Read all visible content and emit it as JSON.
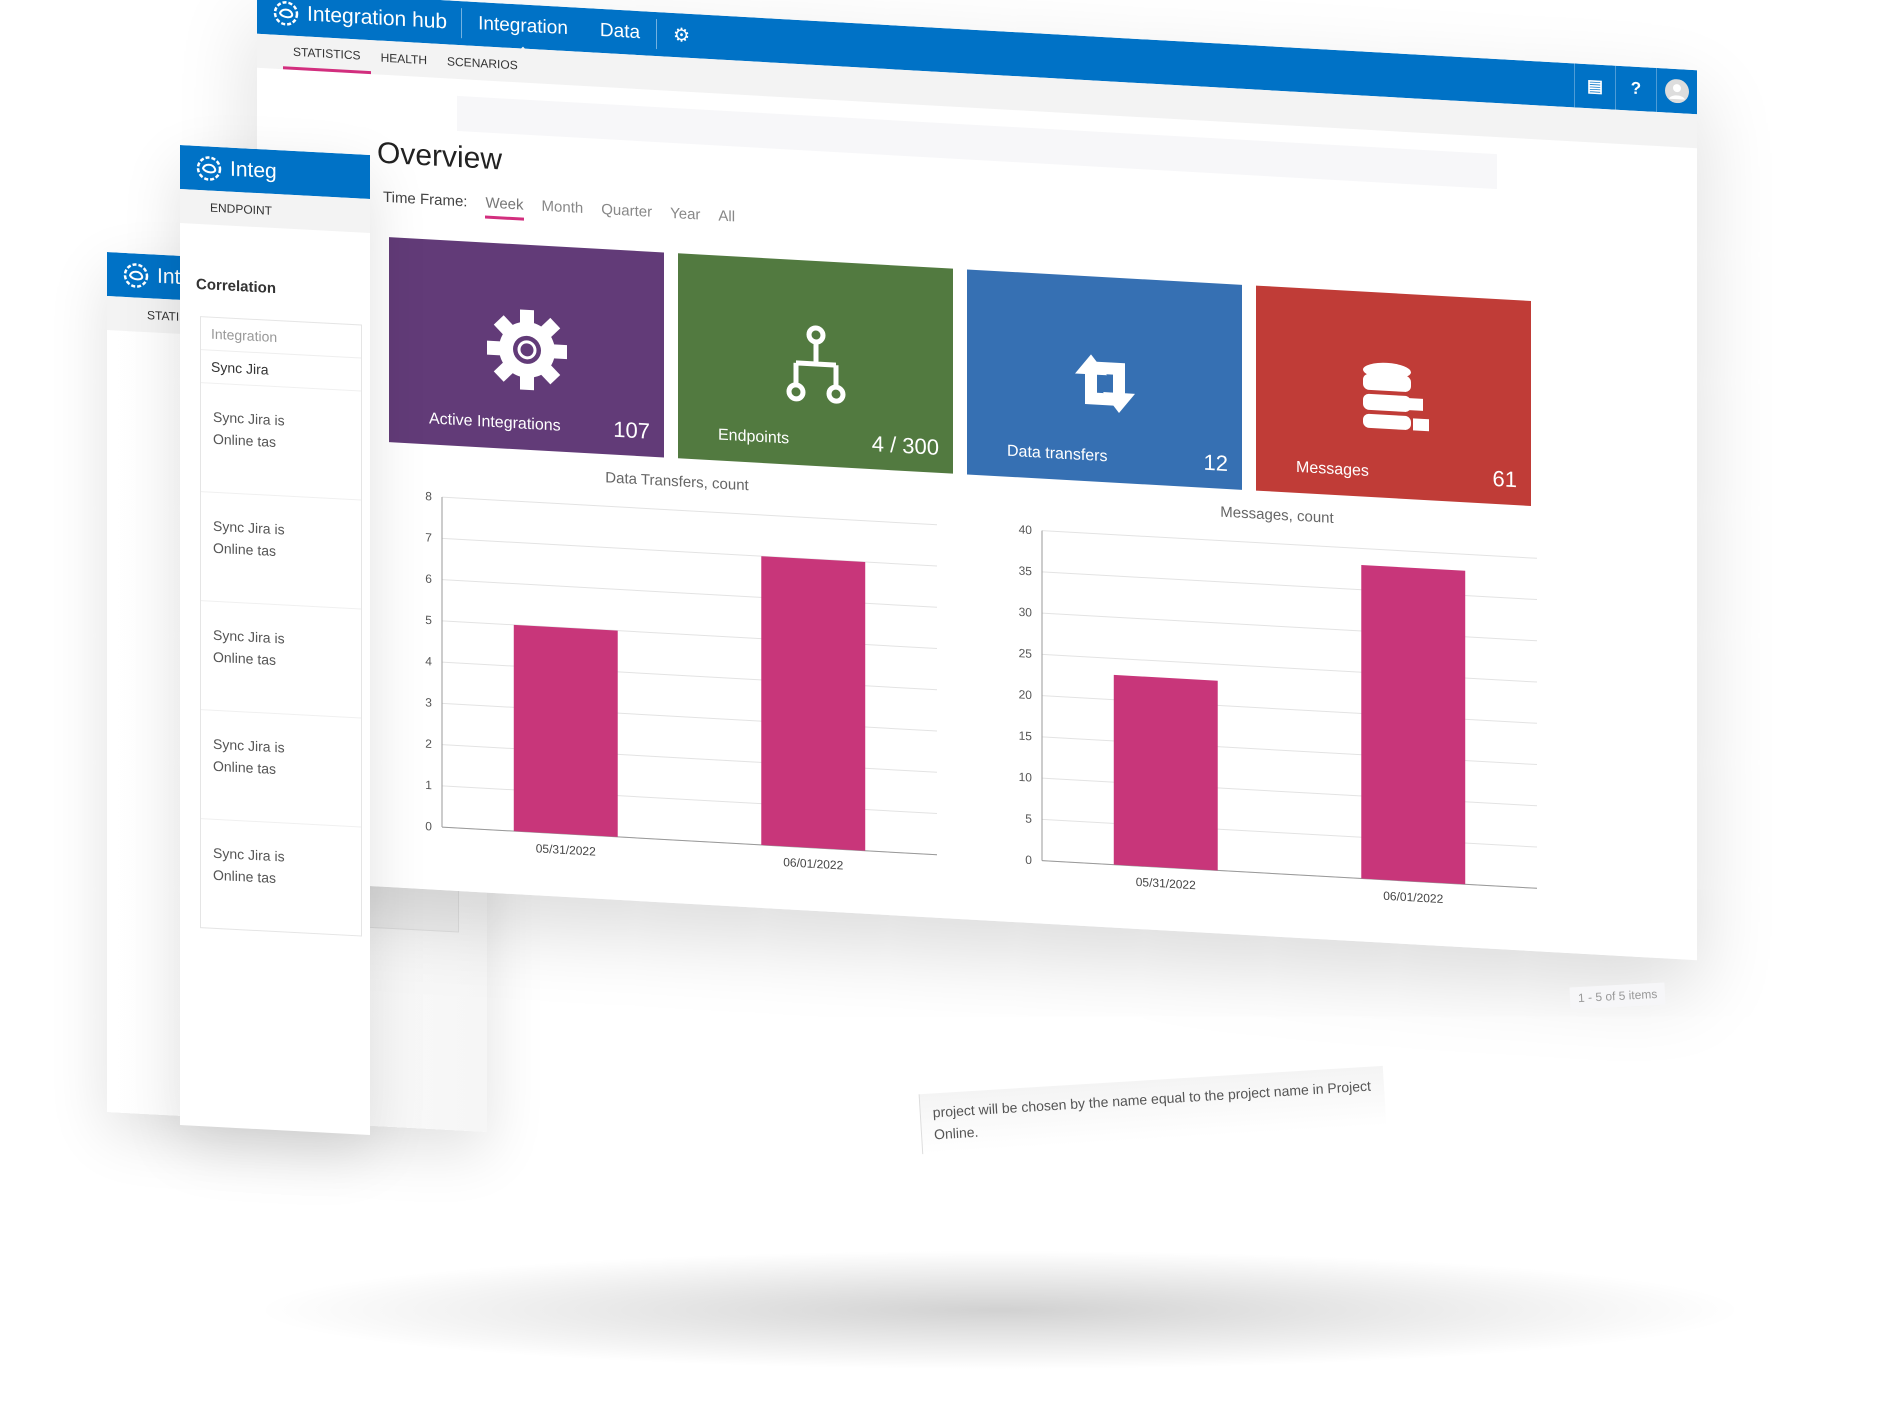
{
  "app": {
    "title": "Integration hub",
    "brand_color": "#0072c6",
    "accent_color": "#d22e7e"
  },
  "back_panel_2": {
    "title": "Integ",
    "subtab": "ENDPOINT",
    "section": "Correlation",
    "column": "Integration",
    "filter": "Sync Jira",
    "rows": [
      {
        "line1": "Sync Jira is",
        "line2": "Online tas"
      },
      {
        "line1": "Sync Jira is",
        "line2": "Online tas"
      },
      {
        "line1": "Sync Jira is",
        "line2": "Online tas"
      },
      {
        "line1": "Sync Jira is",
        "line2": "Online tas"
      },
      {
        "line1": "Sync Jira is",
        "line2": "Online tas"
      }
    ],
    "pager": "1 - 5 of 5 items"
  },
  "back_panel_3": {
    "title": "Inte",
    "subtab": "STATISTIC",
    "tab": "In",
    "description": "project will be chosen by the name equal to the project name in Project Online."
  },
  "nav": {
    "items": [
      {
        "label": "Integration",
        "active": true
      },
      {
        "label": "Data"
      }
    ],
    "settings_icon": "gear-icon"
  },
  "subnav": {
    "items": [
      {
        "label": "STATISTICS",
        "active": true
      },
      {
        "label": "HEALTH"
      },
      {
        "label": "SCENARIOS"
      }
    ]
  },
  "header_icons": [
    "chat-icon",
    "help-icon",
    "user-avatar"
  ],
  "help_label": "?",
  "overview": {
    "title": "Overview",
    "timeframe_label": "Time Frame:",
    "timeframe_options": [
      {
        "label": "Week",
        "active": true
      },
      {
        "label": "Month"
      },
      {
        "label": "Quarter"
      },
      {
        "label": "Year"
      },
      {
        "label": "All"
      }
    ],
    "tiles": [
      {
        "label": "Active Integrations",
        "value": "107",
        "color": "#623b78",
        "icon": "gear-icon"
      },
      {
        "label": "Endpoints",
        "value": "4 / 300",
        "color": "#527a40",
        "icon": "hierarchy-icon"
      },
      {
        "label": "Data transfers",
        "value": "12",
        "color": "#3670b3",
        "icon": "sync-arrows-icon"
      },
      {
        "label": "Messages",
        "value": "61",
        "color": "#c03c37",
        "icon": "database-mail-icon"
      }
    ]
  },
  "chart_data": [
    {
      "type": "bar",
      "title": "Data Transfers, count",
      "categories": [
        "05/31/2022",
        "06/01/2022"
      ],
      "values": [
        5,
        7
      ],
      "ylim": [
        0,
        8
      ],
      "yticks": [
        0,
        1,
        2,
        3,
        4,
        5,
        6,
        7,
        8
      ],
      "grid": true,
      "color": "#c8367a"
    },
    {
      "type": "bar",
      "title": "Messages, count",
      "categories": [
        "05/31/2022",
        "06/01/2022"
      ],
      "values": [
        23,
        38
      ],
      "ylim": [
        0,
        40
      ],
      "yticks": [
        0,
        5,
        10,
        15,
        20,
        25,
        30,
        35,
        40
      ],
      "grid": true,
      "color": "#c8367a"
    }
  ]
}
